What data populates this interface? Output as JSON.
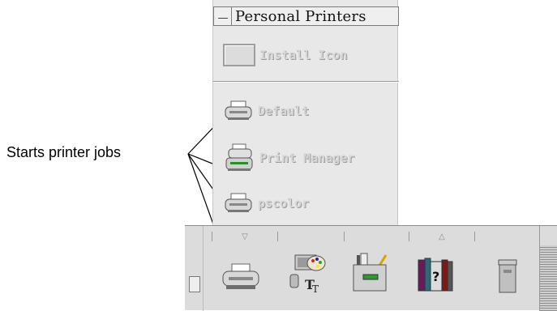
{
  "subpanel": {
    "title": "Personal Printers",
    "install_label": "Install Icon",
    "items": [
      {
        "label": "Default",
        "icon": "printer-icon"
      },
      {
        "label": "Print Manager",
        "icon": "print-manager-icon"
      },
      {
        "label": "pscolor",
        "icon": "printer-icon"
      }
    ]
  },
  "callout": {
    "text": "Starts printer jobs"
  },
  "front_panel": {
    "arrow_up": "▽",
    "arrow_down": "△",
    "icons": [
      "printer-icon",
      "style-manager-icon",
      "file-manager-icon",
      "help-icon",
      "trash-icon"
    ]
  }
}
